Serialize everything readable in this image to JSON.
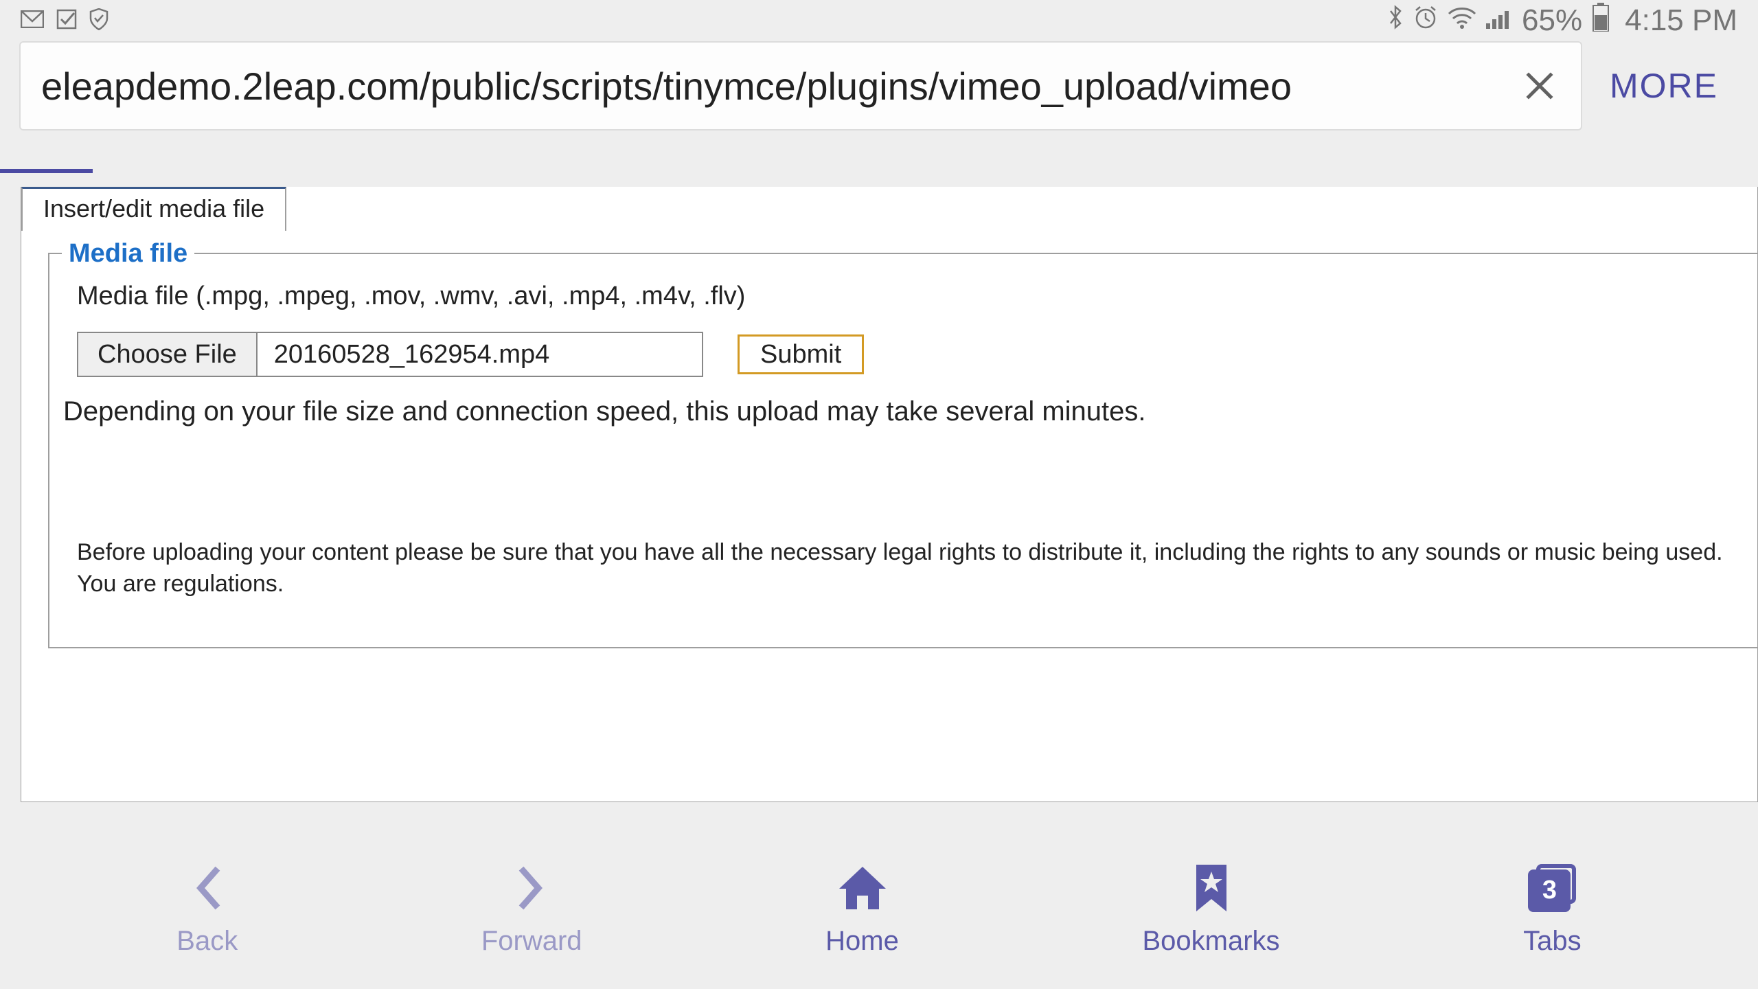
{
  "status": {
    "battery_pct": "65%",
    "time": "4:15 PM"
  },
  "urlbar": {
    "url": "eleapdemo.2leap.com/public/scripts/tinymce/plugins/vimeo_upload/vimeo",
    "more_label": "MORE"
  },
  "dialog": {
    "tab_label": "Insert/edit media file",
    "legend": "Media file",
    "file_types_label": "Media file (.mpg, .mpeg, .mov, .wmv, .avi, .mp4, .m4v, .flv)",
    "choose_file_label": "Choose File",
    "selected_file": "20160528_162954.mp4",
    "submit_label": "Submit",
    "upload_note": "Depending on your file size and connection speed, this upload may take several minutes.",
    "legal_note": "Before uploading your content please be sure that you have all the necessary legal rights to distribute it, including the rights to any sounds or music being used. You are regulations."
  },
  "nav": {
    "back": "Back",
    "forward": "Forward",
    "home": "Home",
    "bookmarks": "Bookmarks",
    "tabs": "Tabs",
    "tabs_count": "3"
  }
}
